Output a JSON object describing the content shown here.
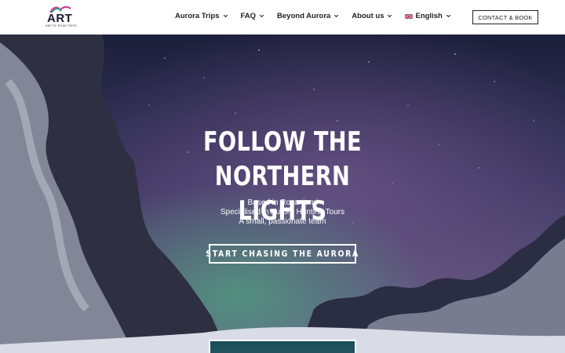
{
  "logo": {
    "text": "ART",
    "tagline": "ARCTIC ROAD TRIPS"
  },
  "nav": {
    "items": [
      {
        "label": "Aurora Trips",
        "icon": "chevron-down-icon"
      },
      {
        "label": "FAQ",
        "icon": "chevron-down-icon"
      },
      {
        "label": "Beyond Aurora",
        "icon": "chevron-down-icon"
      },
      {
        "label": "About us",
        "icon": "chevron-down-icon"
      },
      {
        "label": "English",
        "icon": "chevron-down-icon",
        "flag": "uk-flag-icon"
      }
    ],
    "cta_label": "CONTACT & BOOK"
  },
  "hero": {
    "title_line1": "FOLLOW THE NORTHERN",
    "title_line2": "LIGHTS",
    "sub1": "Based in Rovaniemi",
    "sub2": "Specialised in Aurora Hunting Tours",
    "sub3": "A small, passionate team",
    "button_label": "START CHASING THE AURORA"
  },
  "colors": {
    "header_bg": "#ffffff",
    "text_dark": "#222222",
    "sky_top": "#1c1f3a",
    "sky_mid": "#4a4470",
    "aurora": "#3f7a6a",
    "snow": "#d9dbe6"
  }
}
